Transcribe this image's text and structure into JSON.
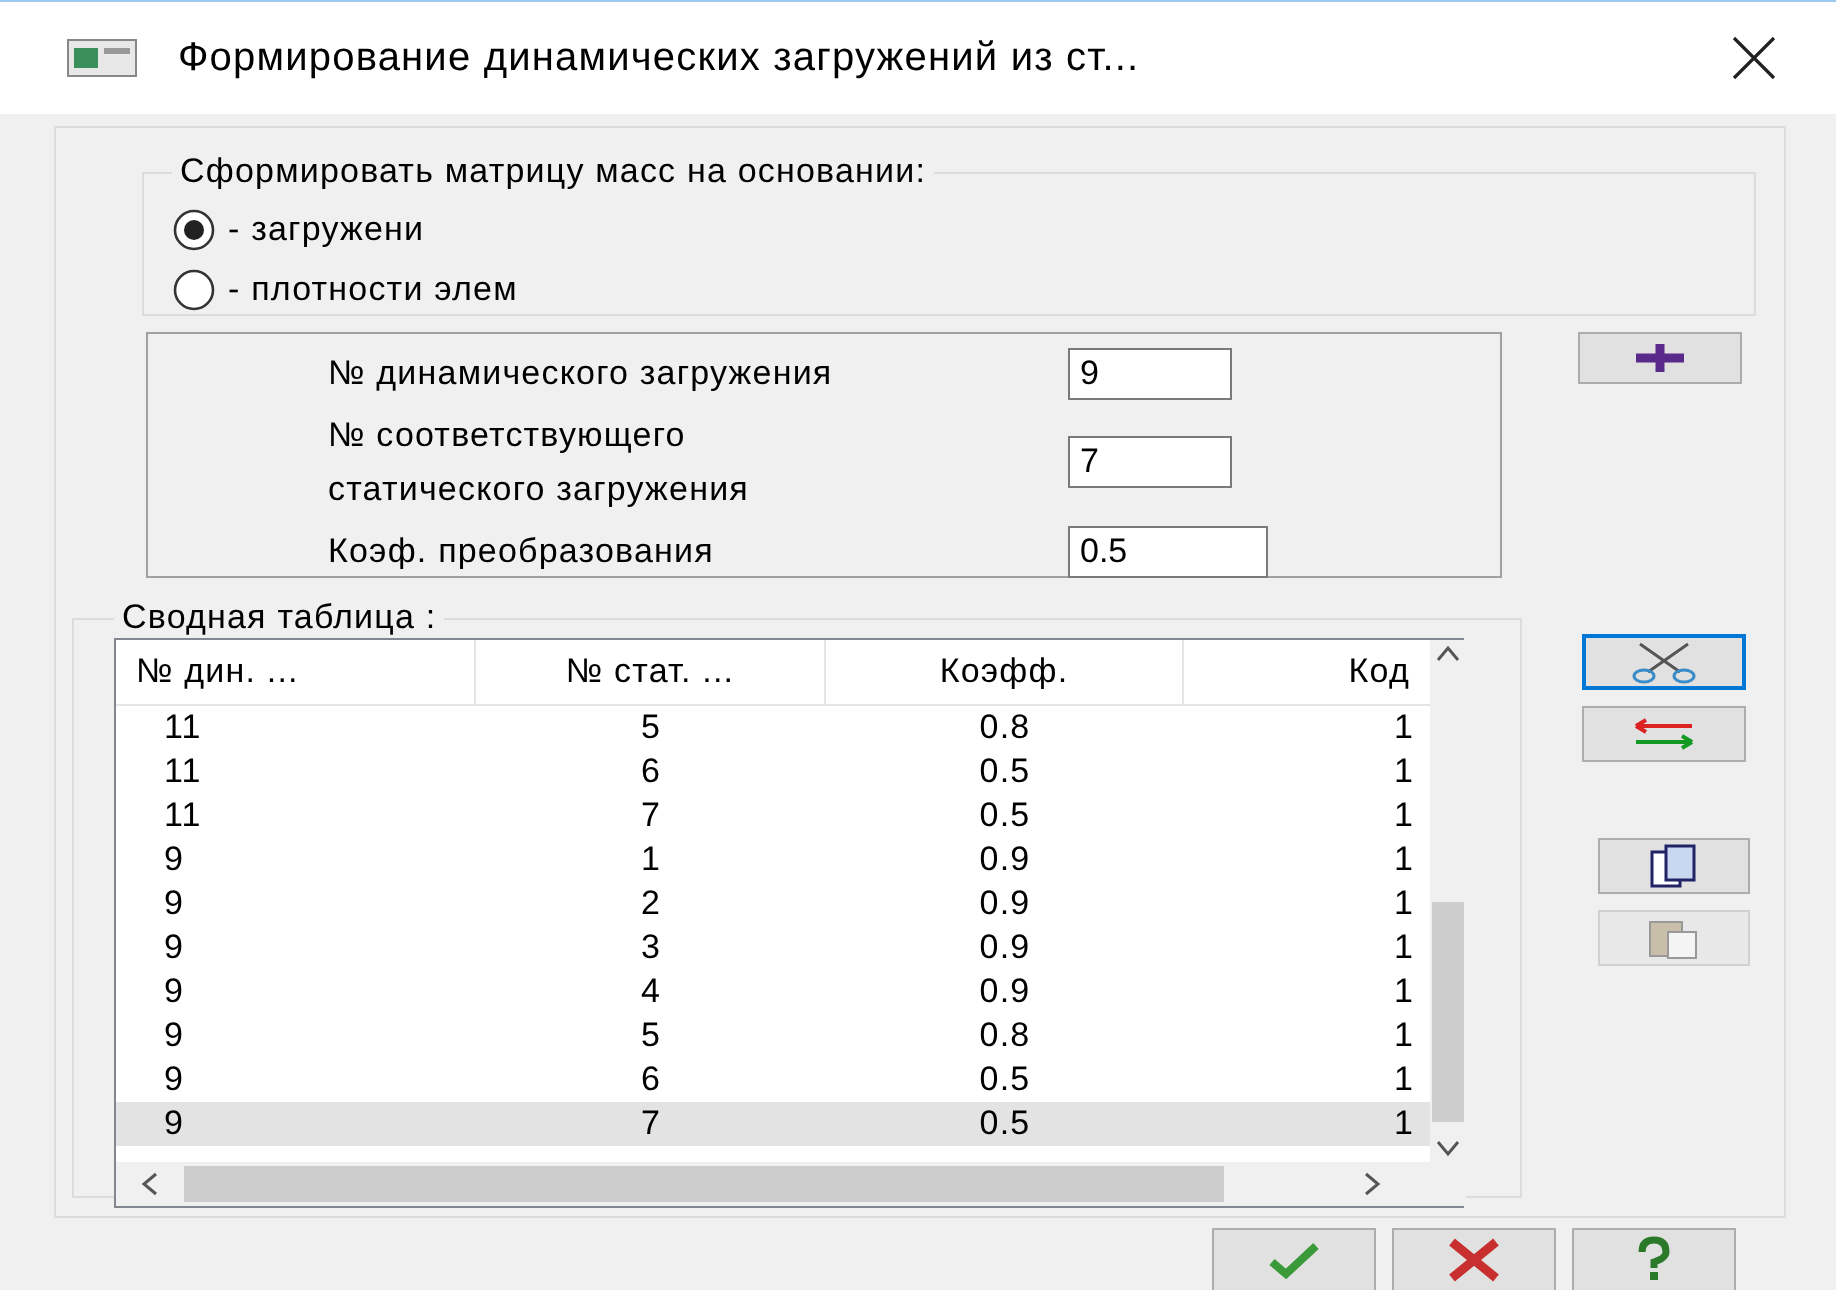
{
  "window": {
    "title": "Формирование динамических загружений из ст..."
  },
  "mass_matrix": {
    "label": "Сформировать матрицу масс на основании:",
    "options": [
      {
        "label": "- загружени",
        "selected": true
      },
      {
        "label": "- плотности элем",
        "selected": false
      }
    ]
  },
  "fields": [
    {
      "label": "№  динамического загружения",
      "value": "9"
    },
    {
      "label": "№ соответствующего статического загружения",
      "value": "7"
    },
    {
      "label": "Коэф. преобразования",
      "value": "0.5"
    }
  ],
  "summary": {
    "label": "Сводная таблица :",
    "columns": [
      "№ дин. ...",
      "№ стат. ...",
      "Коэфф.",
      "Код"
    ],
    "rows": [
      {
        "cells": [
          "11",
          "5",
          "0.8",
          "1"
        ],
        "selected": false
      },
      {
        "cells": [
          "11",
          "6",
          "0.5",
          "1"
        ],
        "selected": false
      },
      {
        "cells": [
          "11",
          "7",
          "0.5",
          "1"
        ],
        "selected": false
      },
      {
        "cells": [
          "9",
          "1",
          "0.9",
          "1"
        ],
        "selected": false
      },
      {
        "cells": [
          "9",
          "2",
          "0.9",
          "1"
        ],
        "selected": false
      },
      {
        "cells": [
          "9",
          "3",
          "0.9",
          "1"
        ],
        "selected": false
      },
      {
        "cells": [
          "9",
          "4",
          "0.9",
          "1"
        ],
        "selected": false
      },
      {
        "cells": [
          "9",
          "5",
          "0.8",
          "1"
        ],
        "selected": false
      },
      {
        "cells": [
          "9",
          "6",
          "0.5",
          "1"
        ],
        "selected": false
      },
      {
        "cells": [
          "9",
          "7",
          "0.5",
          "1"
        ],
        "selected": true
      }
    ]
  },
  "side_buttons": [
    {
      "kind": "cut",
      "focused": true,
      "disabled": false
    },
    {
      "kind": "swap",
      "focused": false,
      "disabled": false
    },
    {
      "kind": "copy",
      "focused": false,
      "disabled": false
    },
    {
      "kind": "paste",
      "focused": false,
      "disabled": true
    }
  ],
  "dialog_buttons": [
    {
      "kind": "ok"
    },
    {
      "kind": "cancel"
    },
    {
      "kind": "help"
    }
  ]
}
